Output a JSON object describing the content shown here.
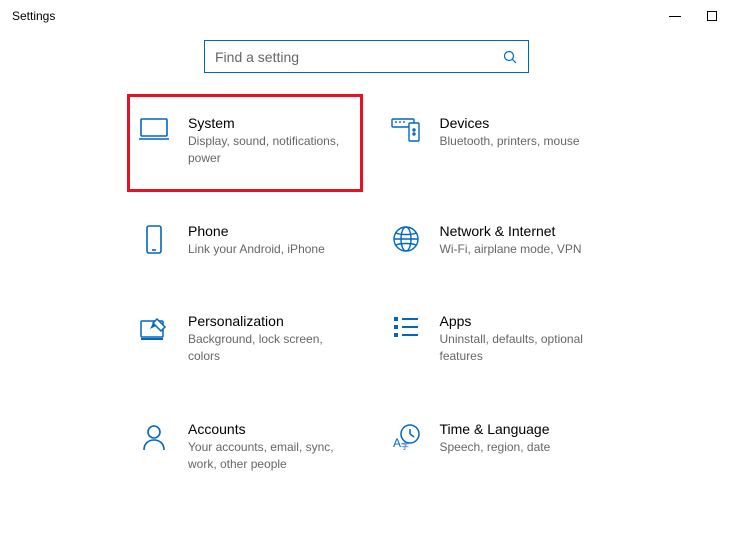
{
  "window": {
    "title": "Settings"
  },
  "search": {
    "placeholder": "Find a setting"
  },
  "tiles": {
    "system": {
      "title": "System",
      "desc": "Display, sound, notifications, power"
    },
    "devices": {
      "title": "Devices",
      "desc": "Bluetooth, printers, mouse"
    },
    "phone": {
      "title": "Phone",
      "desc": "Link your Android, iPhone"
    },
    "network": {
      "title": "Network & Internet",
      "desc": "Wi-Fi, airplane mode, VPN"
    },
    "personal": {
      "title": "Personalization",
      "desc": "Background, lock screen, colors"
    },
    "apps": {
      "title": "Apps",
      "desc": "Uninstall, defaults, optional features"
    },
    "accounts": {
      "title": "Accounts",
      "desc": "Your accounts, email, sync, work, other people"
    },
    "timelang": {
      "title": "Time & Language",
      "desc": "Speech, region, date"
    }
  }
}
